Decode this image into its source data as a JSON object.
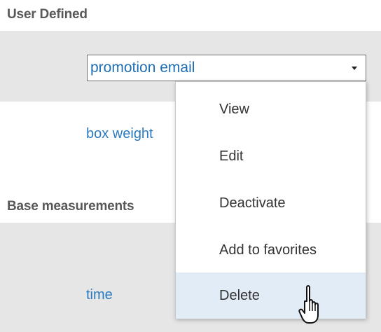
{
  "sections": [
    {
      "heading": "User Defined"
    },
    {
      "heading": "Base measurements"
    }
  ],
  "fields": {
    "select_value": "promotion email",
    "link_box_weight": "box weight",
    "link_time": "time"
  },
  "context_menu": {
    "items": [
      {
        "label": "View"
      },
      {
        "label": "Edit"
      },
      {
        "label": "Deactivate"
      },
      {
        "label": "Add to favorites"
      },
      {
        "label": "Delete"
      }
    ],
    "hovered": "Delete"
  },
  "icons": {
    "dropdown": "chevron-down-icon",
    "pointer": "hand-pointer-cursor-icon"
  },
  "colors": {
    "heading": "#595959",
    "link": "#2b7bbf",
    "band": "#e6e6e6",
    "hover": "#e1ecf6"
  }
}
